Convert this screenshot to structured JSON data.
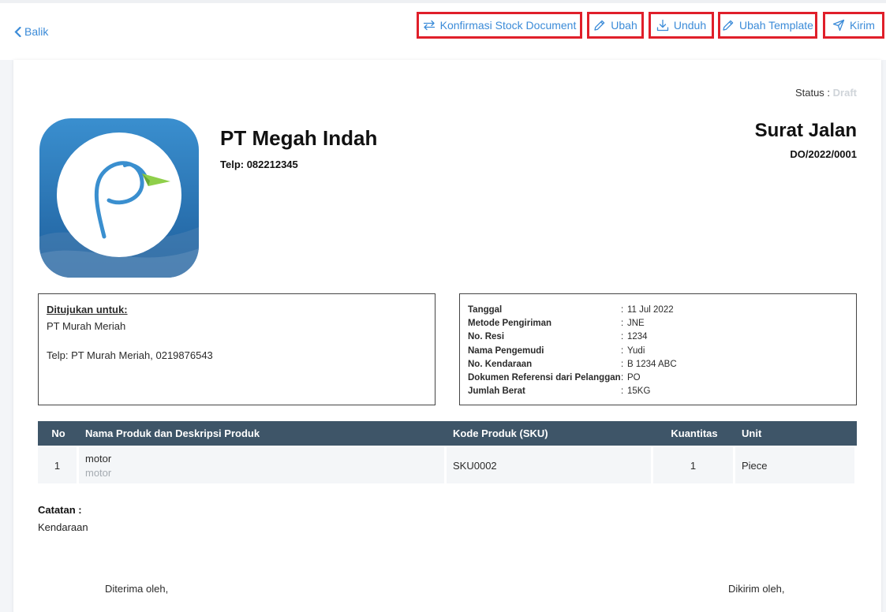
{
  "toolbar": {
    "back_label": "Balik",
    "actions": [
      {
        "label": "Konfirmasi Stock Document",
        "icon": "swap-arrows-icon"
      },
      {
        "label": "Ubah",
        "icon": "pencil-icon"
      },
      {
        "label": "Unduh",
        "icon": "download-icon"
      },
      {
        "label": "Ubah Template",
        "icon": "pencil-icon"
      },
      {
        "label": "Kirim",
        "icon": "send-icon"
      }
    ]
  },
  "document": {
    "status_label": "Status :",
    "status_value": "Draft",
    "company_name": "PT Megah Indah",
    "company_phone": "Telp: 082212345",
    "title": "Surat Jalan",
    "number": "DO/2022/0001",
    "recipient": {
      "heading": "Ditujukan untuk:",
      "name": "PT Murah Meriah",
      "phone": "Telp: PT Murah Meriah, 0219876543"
    },
    "details": [
      {
        "label": "Tanggal",
        "value": "11 Jul 2022"
      },
      {
        "label": "Metode Pengiriman",
        "value": "JNE"
      },
      {
        "label": "No. Resi",
        "value": "1234"
      },
      {
        "label": "Nama Pengemudi",
        "value": "Yudi"
      },
      {
        "label": "No. Kendaraan",
        "value": "B 1234 ABC"
      },
      {
        "label": "Dokumen Referensi dari Pelanggan",
        "value": "PO"
      },
      {
        "label": "Jumlah Berat",
        "value": "15KG"
      }
    ],
    "table": {
      "headers": [
        "No",
        "Nama Produk dan Deskripsi Produk",
        "Kode Produk (SKU)",
        "Kuantitas",
        "Unit"
      ],
      "rows": [
        {
          "no": "1",
          "name": "motor",
          "description": "motor",
          "sku": "SKU0002",
          "qty": "1",
          "unit": "Piece"
        }
      ]
    },
    "notes_label": "Catatan :",
    "notes_value": "Kendaraan",
    "received_by": "Diterima oleh,",
    "sent_by": "Dikirim oleh,"
  },
  "colors": {
    "accent": "#3b8bd8",
    "highlight_border": "#e01f2a",
    "table_header": "#3e5568",
    "status_draft": "#cfd4d9"
  }
}
